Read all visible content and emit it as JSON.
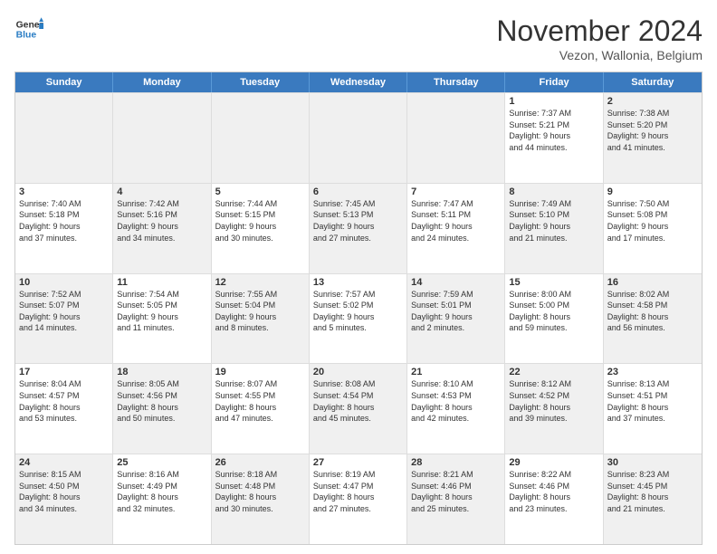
{
  "header": {
    "logo_general": "General",
    "logo_blue": "Blue",
    "month_title": "November 2024",
    "location": "Vezon, Wallonia, Belgium"
  },
  "weekdays": [
    "Sunday",
    "Monday",
    "Tuesday",
    "Wednesday",
    "Thursday",
    "Friday",
    "Saturday"
  ],
  "rows": [
    [
      {
        "day": "",
        "info": "",
        "shaded": true
      },
      {
        "day": "",
        "info": "",
        "shaded": true
      },
      {
        "day": "",
        "info": "",
        "shaded": true
      },
      {
        "day": "",
        "info": "",
        "shaded": true
      },
      {
        "day": "",
        "info": "",
        "shaded": true
      },
      {
        "day": "1",
        "info": "Sunrise: 7:37 AM\nSunset: 5:21 PM\nDaylight: 9 hours\nand 44 minutes."
      },
      {
        "day": "2",
        "info": "Sunrise: 7:38 AM\nSunset: 5:20 PM\nDaylight: 9 hours\nand 41 minutes.",
        "shaded": true
      }
    ],
    [
      {
        "day": "3",
        "info": "Sunrise: 7:40 AM\nSunset: 5:18 PM\nDaylight: 9 hours\nand 37 minutes."
      },
      {
        "day": "4",
        "info": "Sunrise: 7:42 AM\nSunset: 5:16 PM\nDaylight: 9 hours\nand 34 minutes.",
        "shaded": true
      },
      {
        "day": "5",
        "info": "Sunrise: 7:44 AM\nSunset: 5:15 PM\nDaylight: 9 hours\nand 30 minutes."
      },
      {
        "day": "6",
        "info": "Sunrise: 7:45 AM\nSunset: 5:13 PM\nDaylight: 9 hours\nand 27 minutes.",
        "shaded": true
      },
      {
        "day": "7",
        "info": "Sunrise: 7:47 AM\nSunset: 5:11 PM\nDaylight: 9 hours\nand 24 minutes."
      },
      {
        "day": "8",
        "info": "Sunrise: 7:49 AM\nSunset: 5:10 PM\nDaylight: 9 hours\nand 21 minutes.",
        "shaded": true
      },
      {
        "day": "9",
        "info": "Sunrise: 7:50 AM\nSunset: 5:08 PM\nDaylight: 9 hours\nand 17 minutes."
      }
    ],
    [
      {
        "day": "10",
        "info": "Sunrise: 7:52 AM\nSunset: 5:07 PM\nDaylight: 9 hours\nand 14 minutes.",
        "shaded": true
      },
      {
        "day": "11",
        "info": "Sunrise: 7:54 AM\nSunset: 5:05 PM\nDaylight: 9 hours\nand 11 minutes."
      },
      {
        "day": "12",
        "info": "Sunrise: 7:55 AM\nSunset: 5:04 PM\nDaylight: 9 hours\nand 8 minutes.",
        "shaded": true
      },
      {
        "day": "13",
        "info": "Sunrise: 7:57 AM\nSunset: 5:02 PM\nDaylight: 9 hours\nand 5 minutes."
      },
      {
        "day": "14",
        "info": "Sunrise: 7:59 AM\nSunset: 5:01 PM\nDaylight: 9 hours\nand 2 minutes.",
        "shaded": true
      },
      {
        "day": "15",
        "info": "Sunrise: 8:00 AM\nSunset: 5:00 PM\nDaylight: 8 hours\nand 59 minutes."
      },
      {
        "day": "16",
        "info": "Sunrise: 8:02 AM\nSunset: 4:58 PM\nDaylight: 8 hours\nand 56 minutes.",
        "shaded": true
      }
    ],
    [
      {
        "day": "17",
        "info": "Sunrise: 8:04 AM\nSunset: 4:57 PM\nDaylight: 8 hours\nand 53 minutes."
      },
      {
        "day": "18",
        "info": "Sunrise: 8:05 AM\nSunset: 4:56 PM\nDaylight: 8 hours\nand 50 minutes.",
        "shaded": true
      },
      {
        "day": "19",
        "info": "Sunrise: 8:07 AM\nSunset: 4:55 PM\nDaylight: 8 hours\nand 47 minutes."
      },
      {
        "day": "20",
        "info": "Sunrise: 8:08 AM\nSunset: 4:54 PM\nDaylight: 8 hours\nand 45 minutes.",
        "shaded": true
      },
      {
        "day": "21",
        "info": "Sunrise: 8:10 AM\nSunset: 4:53 PM\nDaylight: 8 hours\nand 42 minutes."
      },
      {
        "day": "22",
        "info": "Sunrise: 8:12 AM\nSunset: 4:52 PM\nDaylight: 8 hours\nand 39 minutes.",
        "shaded": true
      },
      {
        "day": "23",
        "info": "Sunrise: 8:13 AM\nSunset: 4:51 PM\nDaylight: 8 hours\nand 37 minutes."
      }
    ],
    [
      {
        "day": "24",
        "info": "Sunrise: 8:15 AM\nSunset: 4:50 PM\nDaylight: 8 hours\nand 34 minutes.",
        "shaded": true
      },
      {
        "day": "25",
        "info": "Sunrise: 8:16 AM\nSunset: 4:49 PM\nDaylight: 8 hours\nand 32 minutes."
      },
      {
        "day": "26",
        "info": "Sunrise: 8:18 AM\nSunset: 4:48 PM\nDaylight: 8 hours\nand 30 minutes.",
        "shaded": true
      },
      {
        "day": "27",
        "info": "Sunrise: 8:19 AM\nSunset: 4:47 PM\nDaylight: 8 hours\nand 27 minutes."
      },
      {
        "day": "28",
        "info": "Sunrise: 8:21 AM\nSunset: 4:46 PM\nDaylight: 8 hours\nand 25 minutes.",
        "shaded": true
      },
      {
        "day": "29",
        "info": "Sunrise: 8:22 AM\nSunset: 4:46 PM\nDaylight: 8 hours\nand 23 minutes."
      },
      {
        "day": "30",
        "info": "Sunrise: 8:23 AM\nSunset: 4:45 PM\nDaylight: 8 hours\nand 21 minutes.",
        "shaded": true
      }
    ]
  ]
}
